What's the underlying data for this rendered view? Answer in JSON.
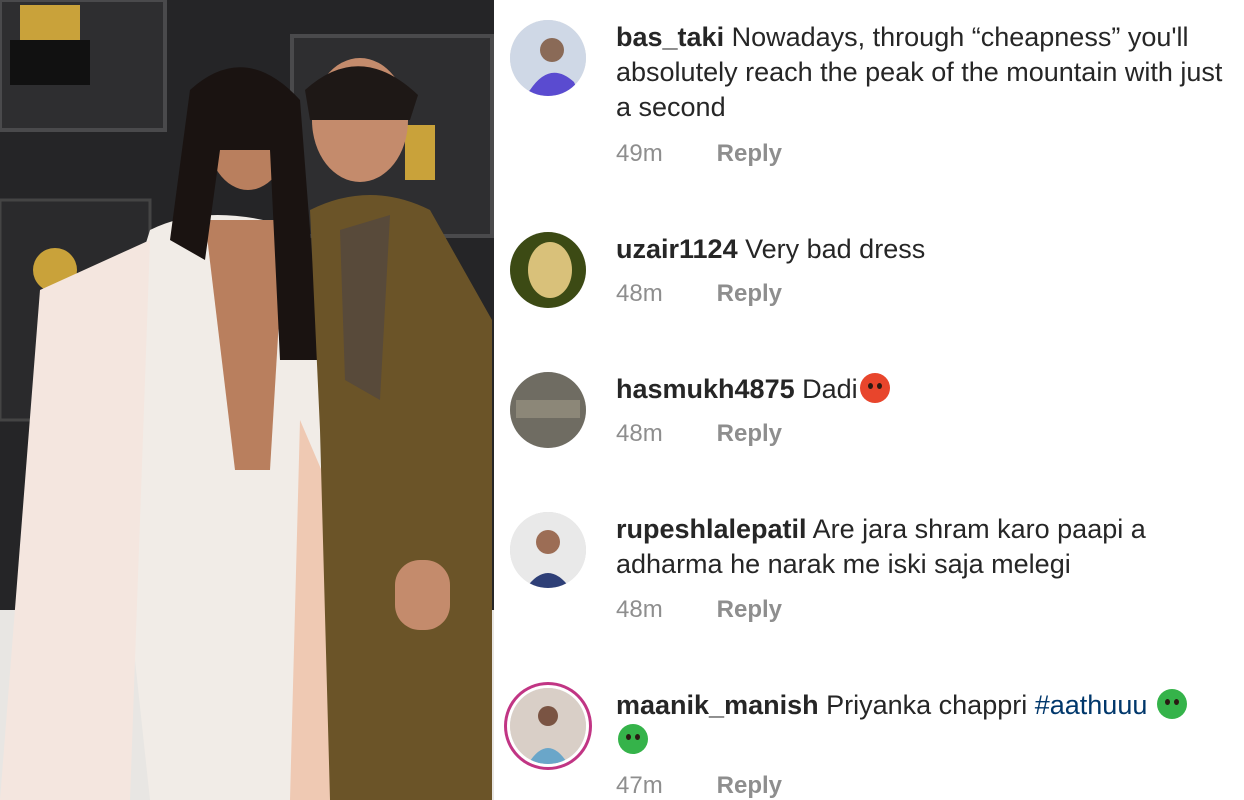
{
  "photo": {
    "alt": "couple-on-red-carpet-photo"
  },
  "comments": [
    {
      "username": "bas_taki",
      "text": "Nowadays, through “cheapness” you'll absolutely reach the peak of the mountain with just a second",
      "time": "49m",
      "reply_label": "Reply"
    },
    {
      "username": "uzair1124",
      "text": "Very bad dress",
      "time": "48m",
      "reply_label": "Reply"
    },
    {
      "username": "hasmukh4875",
      "text": "Dadi",
      "emoji": "angry-face-icon",
      "time": "48m",
      "reply_label": "Reply"
    },
    {
      "username": "rupeshlalepatil",
      "text": "Are jara shram karo paapi a adharma he narak me iski saja melegi",
      "time": "48m",
      "reply_label": "Reply"
    },
    {
      "username": "maanik_manish",
      "text": "Priyanka chappri",
      "hashtag": "#aathuuu",
      "emoji": "nauseated-face-icon",
      "time": "47m",
      "reply_label": "Reply"
    }
  ],
  "colors": {
    "username": "#262626",
    "meta": "#8e8e8e",
    "hashtag": "#00376b",
    "story_ring": "#c13584"
  }
}
